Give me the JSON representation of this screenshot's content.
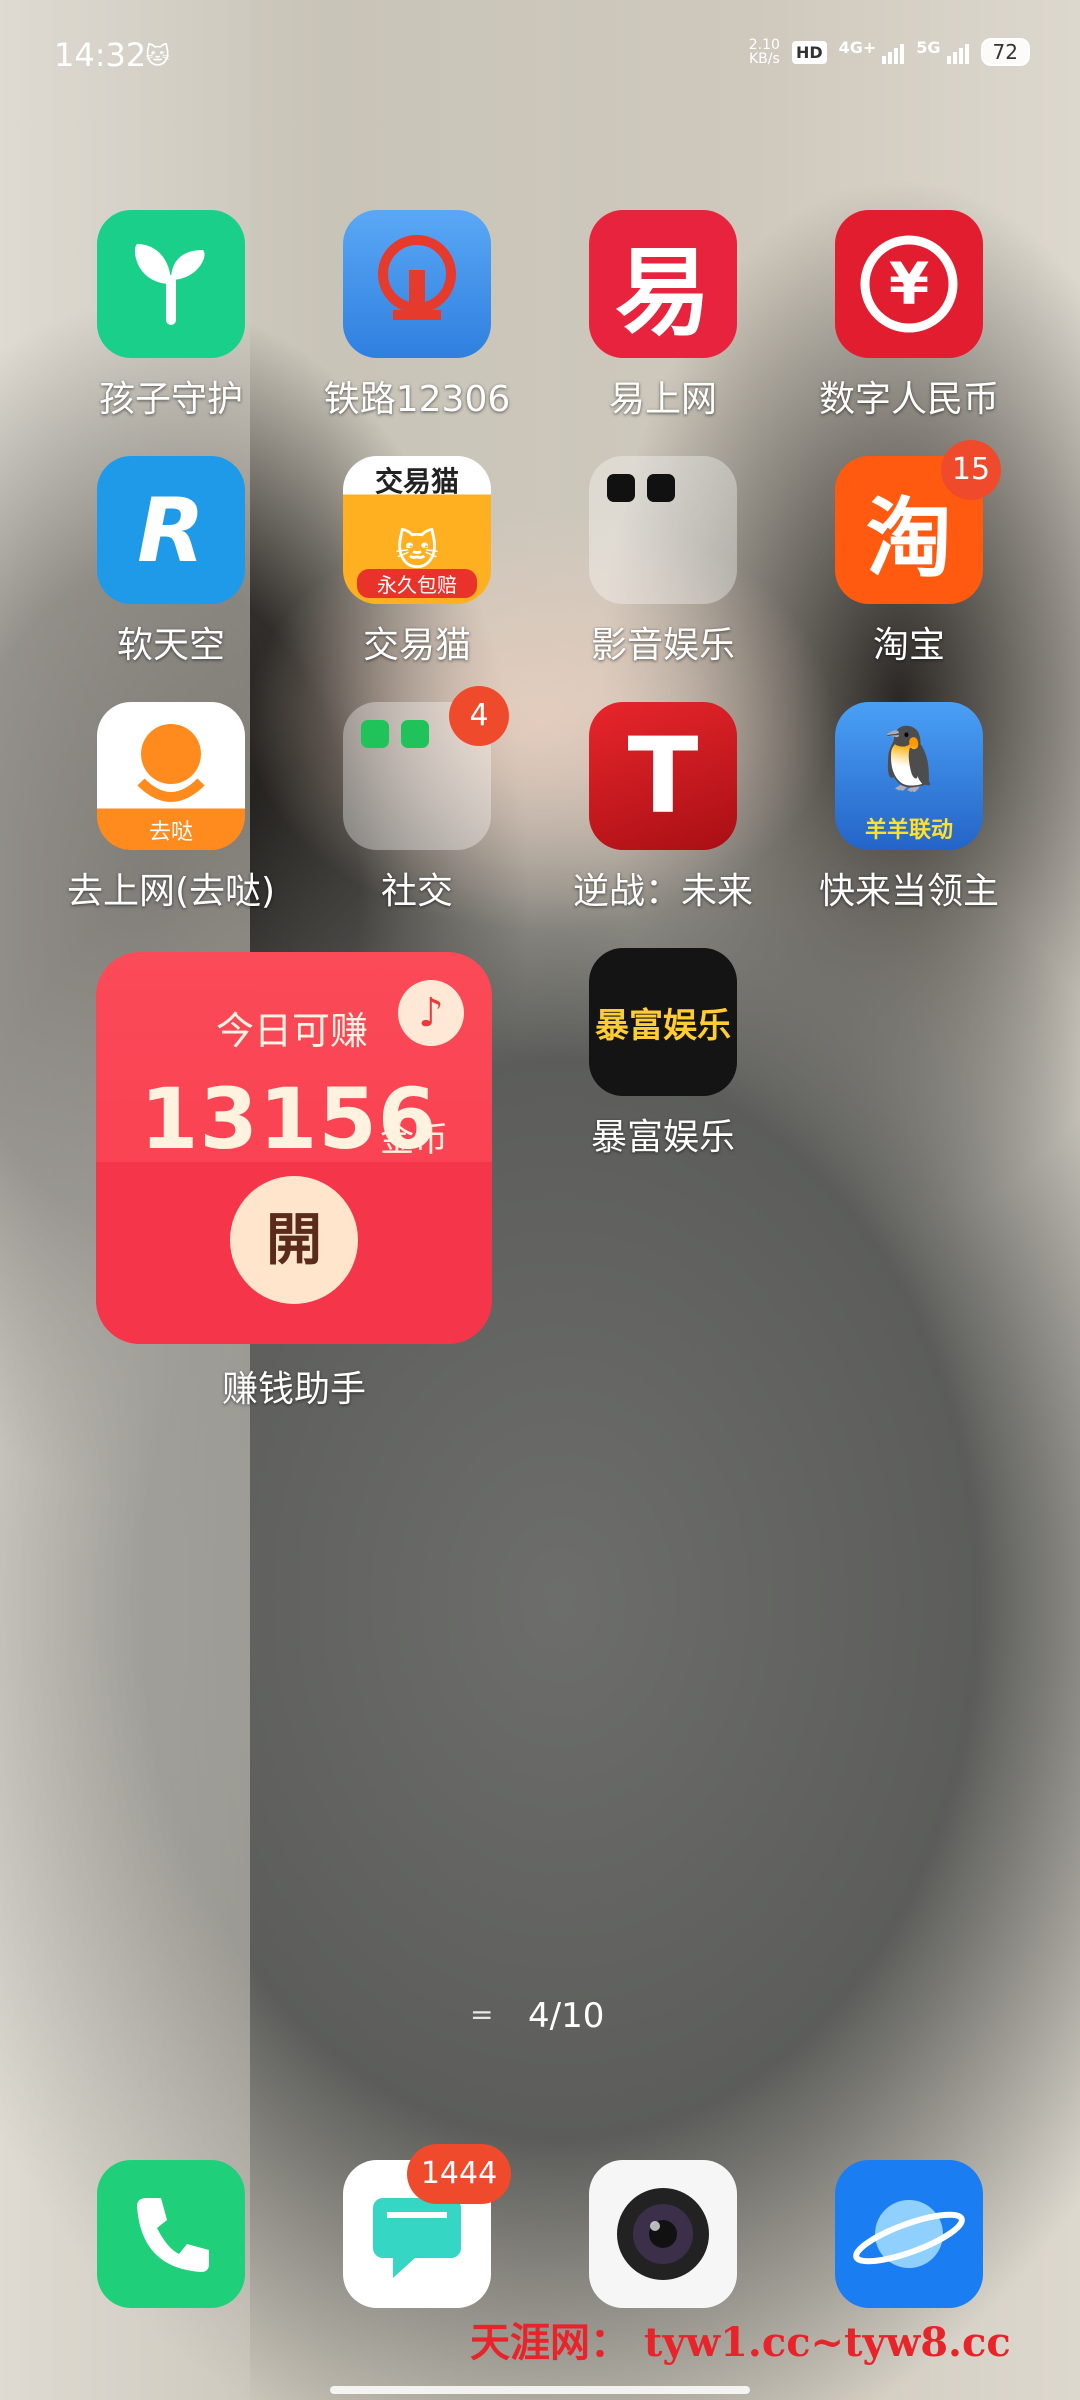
{
  "status": {
    "time": "14:32",
    "net_speed_value": "2.10",
    "net_speed_unit": "KB/s",
    "hd": "HD",
    "net1": "4G+",
    "net2": "5G",
    "battery": "72"
  },
  "apps": [
    {
      "label": "孩子守护",
      "icon": "sprout-icon",
      "color": "#19cf8a"
    },
    {
      "label": "铁路12306",
      "icon": "railway-icon",
      "color": "#3b8ff0"
    },
    {
      "label": "易上网",
      "icon": "yi-icon",
      "color": "#e8233d",
      "glyph": "易"
    },
    {
      "label": "数字人民币",
      "icon": "yuan-icon",
      "color": "#e21d2f",
      "glyph": "¥"
    },
    {
      "label": "软天空",
      "icon": "r-icon",
      "color": "#1f9ae8",
      "glyph": "R"
    },
    {
      "label": "交易猫",
      "icon": "cat-icon",
      "color": "#ffb020",
      "glyph": "交易猫",
      "sub": "永久包赔"
    },
    {
      "label": "影音娱乐",
      "icon": "folder-icon",
      "color": "#ffffff"
    },
    {
      "label": "淘宝",
      "icon": "taobao-icon",
      "color": "#ff5a10",
      "glyph": "淘",
      "badge": "15"
    },
    {
      "label": "去上网(去哒)",
      "icon": "quda-icon",
      "color": "#ff8a1e",
      "sub": "去哒"
    },
    {
      "label": "社交",
      "icon": "folder-icon",
      "color": "#ffffff",
      "badge": "4"
    },
    {
      "label": "逆战：未来",
      "icon": "game-t-icon",
      "color": "#d3171d",
      "glyph": "T"
    },
    {
      "label": "快来当领主",
      "icon": "penguin-icon",
      "color": "#2f7fe0",
      "sub": "羊羊联动"
    },
    {
      "label": "暴富娱乐",
      "icon": "baofu-icon",
      "color": "#141414",
      "glyph": "暴富娱乐"
    }
  ],
  "widget": {
    "title": "今日可赚",
    "amount": "13156",
    "unit": "金币",
    "button": "開",
    "label": "赚钱助手"
  },
  "pager": {
    "label": "4/10"
  },
  "dock": [
    {
      "name": "phone",
      "icon": "phone-icon",
      "color": "#1fcf7a"
    },
    {
      "name": "messages",
      "icon": "message-icon",
      "color": "#ffffff",
      "badge": "1444"
    },
    {
      "name": "camera",
      "icon": "camera-icon",
      "color": "#ffffff"
    },
    {
      "name": "browser",
      "icon": "planet-icon",
      "color": "#1a7df2"
    }
  ],
  "watermark": "天涯网： tyw1.cc~tyw8.cc"
}
